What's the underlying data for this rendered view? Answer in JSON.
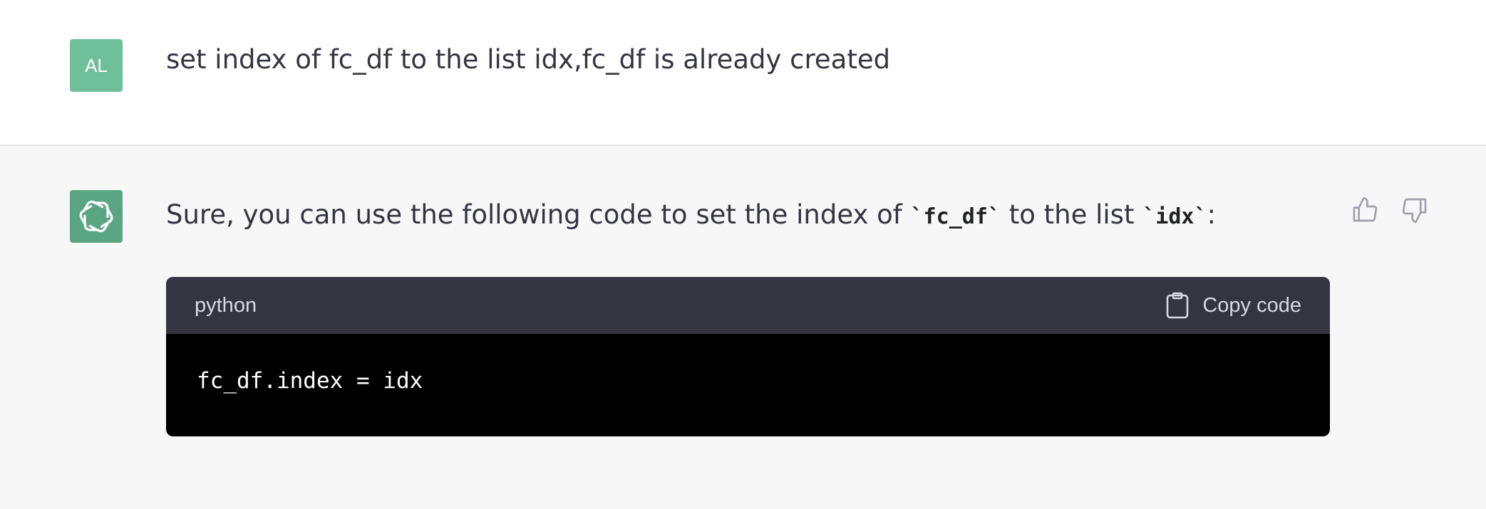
{
  "user_message": {
    "avatar_initials": "AL",
    "avatar_color": "#6fbf9b",
    "text": "set index of fc_df to the list idx,fc_df is already created"
  },
  "assistant_message": {
    "avatar_icon": "openai-logo-icon",
    "avatar_color": "#5aa684",
    "text_part1": "Sure, you can use the following code to set the index of ",
    "inline_code1": "`fc_df`",
    "text_part2": " to the list ",
    "inline_code2": "`idx`",
    "text_part3": ":",
    "feedback": {
      "thumbs_up_icon": "thumbs-up-icon",
      "thumbs_down_icon": "thumbs-down-icon"
    },
    "code_block": {
      "language": "python",
      "copy_label": "Copy code",
      "copy_icon": "clipboard-icon",
      "code": "fc_df.index = idx"
    }
  }
}
